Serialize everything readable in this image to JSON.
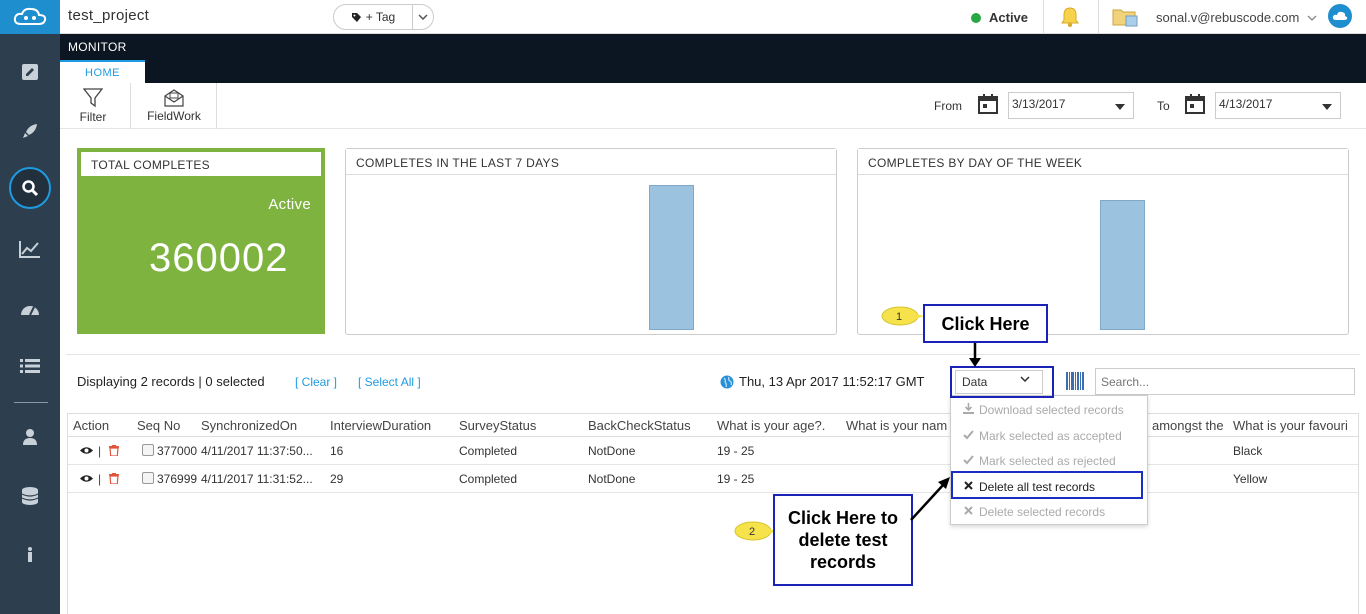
{
  "topbar": {
    "project_title": "test_project",
    "tag_label": "+ Tag",
    "status_label": "Active",
    "status_color": "#27a844",
    "user_email": "sonal.v@rebuscode.com"
  },
  "monitor": {
    "section_label": "MONITOR",
    "tab_home": "HOME"
  },
  "toolbar": {
    "filter_label": "Filter",
    "fieldwork_label": "FieldWork",
    "from_label": "From",
    "from_date": "3/13/2017",
    "to_label": "To",
    "to_date": "4/13/2017"
  },
  "cards": {
    "total": {
      "title": "TOTAL COMPLETES",
      "status": "Active",
      "value": "360002",
      "color": "#7db33e"
    },
    "last7": {
      "title": "COMPLETES IN THE LAST 7 DAYS"
    },
    "dayofweek": {
      "title": "COMPLETES BY DAY OF THE WEEK"
    }
  },
  "chart_data": [
    {
      "type": "bar",
      "values": [
        2
      ]
    },
    {
      "type": "bar",
      "values": [
        2
      ]
    }
  ],
  "records": {
    "summary": "Displaying 2 records | 0 selected",
    "clear_label": "[ Clear ]",
    "select_all_label": "[ Select All ]",
    "timestamp": "Thu, 13 Apr 2017 11:52:17 GMT",
    "data_button": "Data",
    "search_placeholder": "Search..."
  },
  "table": {
    "headers": [
      "Action",
      "Seq No",
      "SynchronizedOn",
      "InterviewDuration",
      "SurveyStatus",
      "BackCheckStatus",
      "What is your age?.",
      "What is your nam",
      "amongst the",
      "What is your favouri"
    ],
    "rows": [
      {
        "seq": "377000",
        "synced": "4/11/2017 11:37:50...",
        "duration": "16",
        "status": "Completed",
        "backcheck": "NotDone",
        "age": "19 - 25",
        "favourite": "Black"
      },
      {
        "seq": "376999",
        "synced": "4/11/2017 11:31:52...",
        "duration": "29",
        "status": "Completed",
        "backcheck": "NotDone",
        "age": "19 - 25",
        "favourite": "Yellow"
      }
    ]
  },
  "data_menu": {
    "items": [
      "Download selected records",
      "Mark selected as accepted",
      "Mark selected as rejected",
      "Delete all test records",
      "Delete selected records"
    ]
  },
  "annotations": {
    "step1_num": "1",
    "step1_text": "Click Here",
    "step2_num": "2",
    "step2_text": "Click Here to delete test records"
  }
}
